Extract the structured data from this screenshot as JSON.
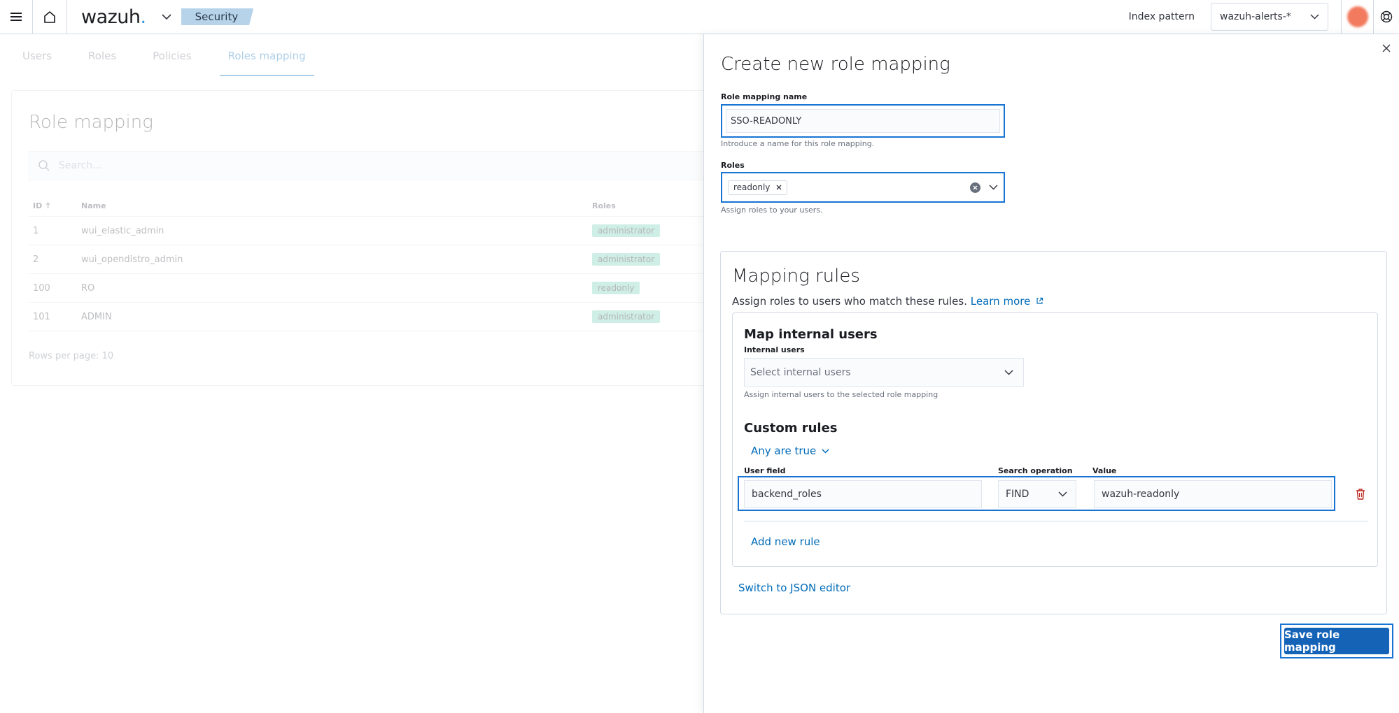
{
  "header": {
    "logo_text": "wazuh",
    "logo_dot": ".",
    "breadcrumb": "Security",
    "index_pattern_label": "Index pattern",
    "index_pattern_value": "wazuh-alerts-*"
  },
  "background": {
    "tabs": [
      {
        "label": "Users"
      },
      {
        "label": "Roles"
      },
      {
        "label": "Policies"
      },
      {
        "label": "Roles mapping"
      }
    ],
    "title": "Role mapping",
    "search_placeholder": "Search...",
    "columns": {
      "id": "ID ↑",
      "name": "Name",
      "roles": "Roles"
    },
    "rows": [
      {
        "id": "1",
        "name": "wui_elastic_admin",
        "role": "administrator"
      },
      {
        "id": "2",
        "name": "wui_opendistro_admin",
        "role": "administrator"
      },
      {
        "id": "100",
        "name": "RO",
        "role": "readonly"
      },
      {
        "id": "101",
        "name": "ADMIN",
        "role": "administrator"
      }
    ],
    "rows_per_page": "Rows per page: 10"
  },
  "flyout": {
    "title": "Create new role mapping",
    "name_label": "Role mapping name",
    "name_value": "SSO-READONLY",
    "name_help": "Introduce a name for this role mapping.",
    "roles_label": "Roles",
    "roles_chip": "readonly",
    "roles_help": "Assign roles to your users.",
    "mapping": {
      "title": "Mapping rules",
      "desc": "Assign roles to users who match these rules.",
      "learn_more": "Learn more",
      "internal_title": "Map internal users",
      "internal_label": "Internal users",
      "internal_placeholder": "Select internal users",
      "internal_help": "Assign internal users to the selected role mapping",
      "custom_title": "Custom rules",
      "any_true": "Any are true",
      "user_field_label": "User field",
      "search_op_label": "Search operation",
      "value_label": "Value",
      "user_field_value": "backend_roles",
      "search_op_value": "FIND",
      "value_value": "wazuh-readonly",
      "add_rule": "Add new rule",
      "json_editor": "Switch to JSON editor"
    },
    "save_button": "Save role mapping"
  },
  "colors": {
    "accent": "#006bb8",
    "focus_border": "#1873d3",
    "save_button": "#1463b7",
    "danger": "#bd271e",
    "breadcrumb_bg": "#b7d3ea"
  }
}
